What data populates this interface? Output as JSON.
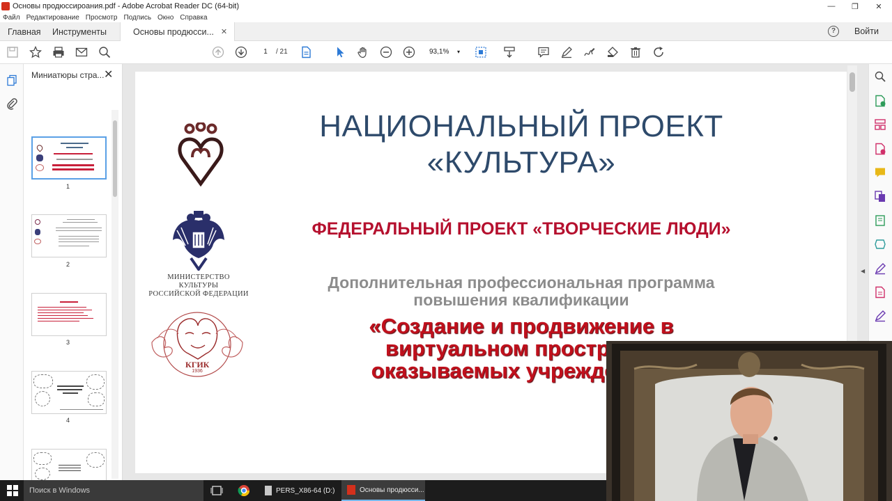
{
  "window": {
    "title": "Основы продюссироания.pdf - Adobe Acrobat Reader DC (64-bit)",
    "minimize": "—",
    "maximize": "❐",
    "close": "✕"
  },
  "menu": [
    "Файл",
    "Редактирование",
    "Просмотр",
    "Подпись",
    "Окно",
    "Справка"
  ],
  "tabs": {
    "home": "Главная",
    "tools": "Инструменты",
    "document": "Основы продюсси...",
    "document_close": "✕",
    "help": "?",
    "signin": "Войти"
  },
  "toolbar": {
    "current_page": "1",
    "total_pages": "/ 21",
    "zoom": "93,1%",
    "zoom_caret": "▾"
  },
  "thumbnails": {
    "title": "Миниатюры стра...",
    "close": "✕",
    "pages": [
      "1",
      "2",
      "3",
      "4"
    ]
  },
  "slide": {
    "national_line1": "НАЦИОНАЛЬНЫЙ ПРОЕКТ",
    "national_line2": "«КУЛЬТУРА»",
    "federal": "ФЕДЕРАЛЬНЫЙ ПРОЕКТ «ТВОРЧЕСКИЕ ЛЮДИ»",
    "program_line1": "Дополнительная профессиональная программа",
    "program_line2": "повышения квалификации",
    "course_line1": "«Создание и продвижение в",
    "course_line2": "виртуальном пространст",
    "course_line3": "оказываемых учреждениям",
    "ministry_line1": "МИНИСТЕРСТВО КУЛЬТУРЫ",
    "ministry_line2": "РОССИЙСКОЙ ФЕДЕРАЦИИ",
    "kgik": "КГИК",
    "kgik_year": "1936"
  },
  "taskbar": {
    "search_placeholder": "Поиск в Windows",
    "item_drive": "PERS_X86-64 (D:)",
    "item_acrobat": "Основы продюсси..."
  },
  "colors": {
    "slide_title": "#2e4a6b",
    "slide_red": "#b5102e",
    "slide_gray": "#8c8c8c",
    "acrobat_red": "#d4301c",
    "right_rail_green": "#2e9c5a",
    "right_rail_pink": "#d0306a",
    "right_rail_purple": "#6a3ab0"
  },
  "icons": {
    "toolbar": [
      "save-icon",
      "bookmark-star-icon",
      "print-icon",
      "email-icon",
      "search-zoom-icon",
      "page-up-icon",
      "page-down-icon",
      "page-view-icon",
      "select-arrow-icon",
      "hand-icon",
      "zoom-out-icon",
      "zoom-in-icon",
      "fit-page-icon",
      "scroll-mode-icon",
      "comment-icon",
      "highlight-pen-icon",
      "sign-icon",
      "stamp-icon",
      "delete-icon",
      "rotate-icon"
    ],
    "right_rail": [
      "search-icon",
      "export-pdf-icon",
      "organize-pages-icon",
      "create-pdf-icon",
      "comment-icon",
      "combine-files-icon",
      "edit-pdf-icon",
      "compress-icon",
      "fill-sign-icon",
      "protect-icon",
      "more-tools-icon"
    ]
  }
}
